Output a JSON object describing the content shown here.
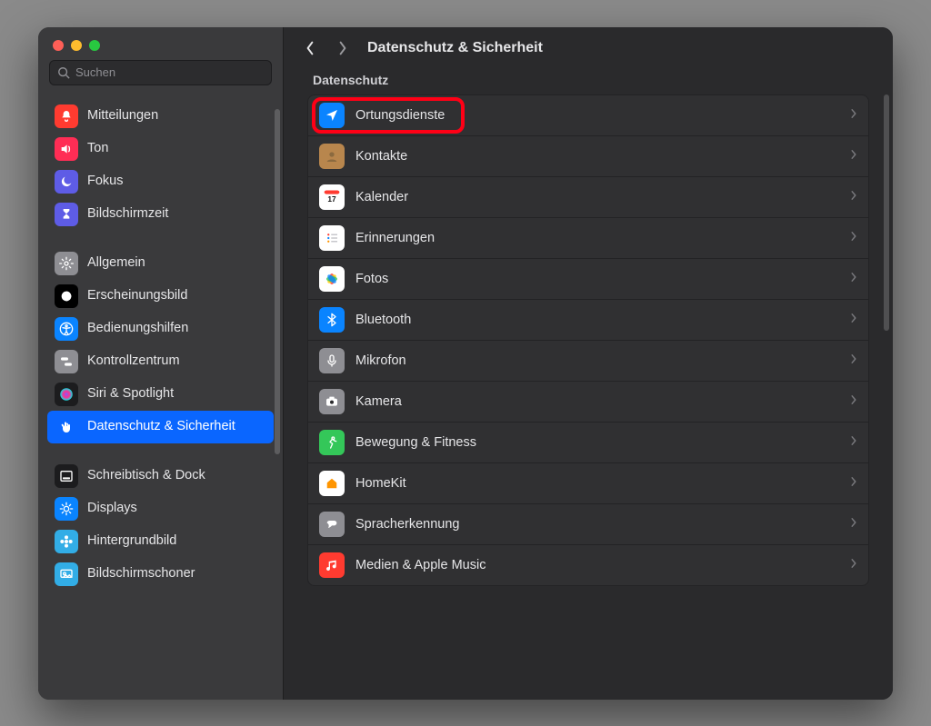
{
  "window": {
    "title": "Datenschutz & Sicherheit"
  },
  "search": {
    "placeholder": "Suchen"
  },
  "sidebar": {
    "groups": [
      {
        "items": [
          {
            "id": "notifications",
            "label": "Mitteilungen",
            "icon": "bell",
            "bg": "#ff3b30"
          },
          {
            "id": "sound",
            "label": "Ton",
            "icon": "speaker",
            "bg": "#ff2d55"
          },
          {
            "id": "focus",
            "label": "Fokus",
            "icon": "moon",
            "bg": "#5e5ce6"
          },
          {
            "id": "screentime",
            "label": "Bildschirmzeit",
            "icon": "hourglass",
            "bg": "#5e5ce6"
          }
        ]
      },
      {
        "items": [
          {
            "id": "general",
            "label": "Allgemein",
            "icon": "gear",
            "bg": "#8e8e93"
          },
          {
            "id": "appearance",
            "label": "Erscheinungsbild",
            "icon": "appearance",
            "bg": "#000000"
          },
          {
            "id": "accessibility",
            "label": "Bedienungshilfen",
            "icon": "accessibility",
            "bg": "#0a84ff"
          },
          {
            "id": "control-center",
            "label": "Kontrollzentrum",
            "icon": "switches",
            "bg": "#8e8e93"
          },
          {
            "id": "siri",
            "label": "Siri & Spotlight",
            "icon": "siri",
            "bg": "#1c1c1e"
          },
          {
            "id": "privacy",
            "label": "Datenschutz & Sicherheit",
            "icon": "hand",
            "bg": "#0a66ff",
            "selected": true
          }
        ]
      },
      {
        "items": [
          {
            "id": "desktop-dock",
            "label": "Schreibtisch & Dock",
            "icon": "dock",
            "bg": "#1c1c1e"
          },
          {
            "id": "displays",
            "label": "Displays",
            "icon": "brightness",
            "bg": "#0a84ff"
          },
          {
            "id": "wallpaper",
            "label": "Hintergrundbild",
            "icon": "flower",
            "bg": "#32ade6"
          },
          {
            "id": "screensaver",
            "label": "Bildschirmschoner",
            "icon": "screensaver",
            "bg": "#32ade6"
          }
        ]
      }
    ]
  },
  "main": {
    "section_label": "Datenschutz",
    "rows": [
      {
        "id": "location",
        "label": "Ortungsdienste",
        "icon": "location",
        "bg": "#0a84ff",
        "highlighted": true
      },
      {
        "id": "contacts",
        "label": "Kontakte",
        "icon": "contacts",
        "bg": "#b8864d"
      },
      {
        "id": "calendar",
        "label": "Kalender",
        "icon": "calendar",
        "bg": "#ffffff",
        "badge": "17"
      },
      {
        "id": "reminders",
        "label": "Erinnerungen",
        "icon": "reminders",
        "bg": "#ffffff"
      },
      {
        "id": "photos",
        "label": "Fotos",
        "icon": "photos",
        "bg": "#ffffff"
      },
      {
        "id": "bluetooth",
        "label": "Bluetooth",
        "icon": "bluetooth",
        "bg": "#0a84ff"
      },
      {
        "id": "microphone",
        "label": "Mikrofon",
        "icon": "microphone",
        "bg": "#8e8e93"
      },
      {
        "id": "camera",
        "label": "Kamera",
        "icon": "camera",
        "bg": "#8e8e93"
      },
      {
        "id": "motion",
        "label": "Bewegung & Fitness",
        "icon": "motion",
        "bg": "#34c759"
      },
      {
        "id": "homekit",
        "label": "HomeKit",
        "icon": "homekit",
        "bg": "#ffffff"
      },
      {
        "id": "speech",
        "label": "Spracherkennung",
        "icon": "speech",
        "bg": "#8e8e93"
      },
      {
        "id": "media",
        "label": "Medien & Apple Music",
        "icon": "music",
        "bg": "#ff3b30"
      }
    ]
  }
}
